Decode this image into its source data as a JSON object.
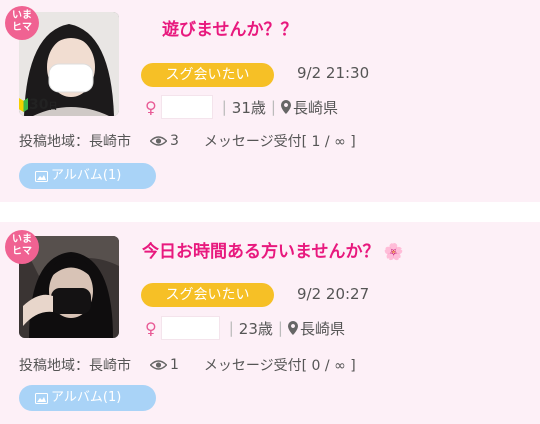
{
  "posts": [
    {
      "badge_line1": "いま",
      "badge_line2": "ヒマ",
      "beginner_days": "30",
      "beginner_unit": "日",
      "title": "遊びませんか？？",
      "tag": "スグ会いたい",
      "datetime": "9/2 21:30",
      "gender_symbol": "♀",
      "age": "31歳",
      "prefecture": "長崎県",
      "area_label": "投稿地域：長崎市",
      "views": "3",
      "message_status": "メッセージ受付[ 1 / ∞ ]",
      "album_label": "アルバム(1)"
    },
    {
      "badge_line1": "いま",
      "badge_line2": "ヒマ",
      "title": "今日お時間ある方いませんか？",
      "title_emoji": "🌸",
      "tag": "スグ会いたい",
      "datetime": "9/2 20:27",
      "gender_symbol": "♀",
      "age": "23歳",
      "prefecture": "長崎県",
      "area_label": "投稿地域：長崎市",
      "views": "1",
      "message_status": "メッセージ受付[ 0 / ∞ ]",
      "album_label": "アルバム(1)"
    }
  ],
  "icons": {
    "location": "map-pin-icon",
    "views": "eye-icon",
    "album": "image-icon",
    "beginner": "beginner-leaf-icon"
  },
  "colors": {
    "card_bg": "#fdf0f7",
    "title": "#e8197e",
    "tag": "#f6c026",
    "album_button": "#a9d3f7",
    "badge": "#f06292"
  }
}
